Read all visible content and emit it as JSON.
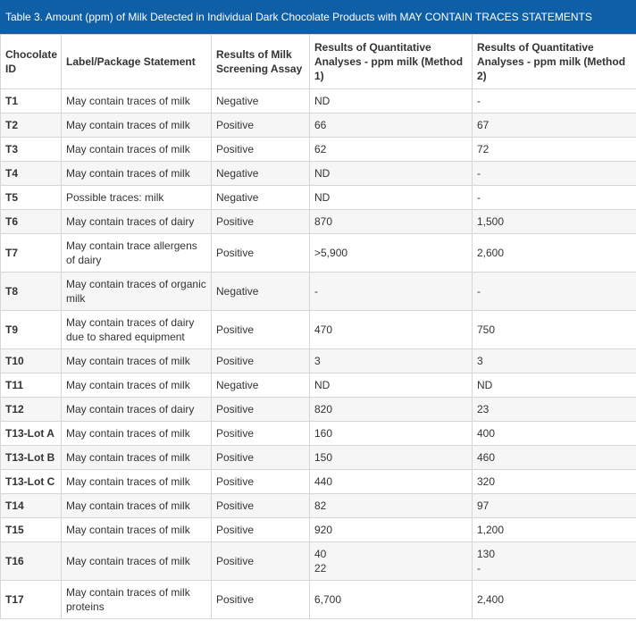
{
  "caption": "Table 3.  Amount (ppm) of Milk Detected in Individual Dark Chocolate Products with MAY CONTAIN TRACES STATEMENTS",
  "headers": [
    "Chocolate ID",
    "Label/Package Statement",
    "Results of Milk Screening Assay",
    "Results of Quantitative Analyses - ppm milk (Method 1)",
    "Results of Quantitative Analyses - ppm milk (Method 2)"
  ],
  "rows": [
    {
      "id": "T1",
      "statement": "May contain traces of milk",
      "screening": "Negative",
      "m1": "ND",
      "m2": "-"
    },
    {
      "id": "T2",
      "statement": "May contain traces of milk",
      "screening": "Positive",
      "m1": "66",
      "m2": "67"
    },
    {
      "id": "T3",
      "statement": "May contain traces of milk",
      "screening": "Positive",
      "m1": "62",
      "m2": "72"
    },
    {
      "id": "T4",
      "statement": "May contain traces of milk",
      "screening": "Negative",
      "m1": "ND",
      "m2": "-"
    },
    {
      "id": "T5",
      "statement": "Possible traces: milk",
      "screening": "Negative",
      "m1": "ND",
      "m2": "-"
    },
    {
      "id": "T6",
      "statement": "May contain traces of dairy",
      "screening": "Positive",
      "m1": "870",
      "m2": "1,500"
    },
    {
      "id": "T7",
      "statement": "May contain trace allergens of dairy",
      "screening": "Positive",
      "m1": ">5,900",
      "m2": "2,600"
    },
    {
      "id": "T8",
      "statement": "May contain traces of organic milk",
      "screening": "Negative",
      "m1": "-",
      "m2": "-"
    },
    {
      "id": "T9",
      "statement": "May contain traces of dairy due to shared equipment",
      "screening": "Positive",
      "m1": "470",
      "m2": "750"
    },
    {
      "id": "T10",
      "statement": "May contain traces of milk",
      "screening": "Positive",
      "m1": "3",
      "m2": "3"
    },
    {
      "id": "T11",
      "statement": "May contain traces of milk",
      "screening": "Negative",
      "m1": "ND",
      "m2": "ND"
    },
    {
      "id": "T12",
      "statement": "May contain traces of dairy",
      "screening": "Positive",
      "m1": "820",
      "m2": "23"
    },
    {
      "id": "T13-Lot A",
      "statement": "May contain traces of milk",
      "screening": "Positive",
      "m1": "160",
      "m2": "400"
    },
    {
      "id": "T13-Lot B",
      "statement": "May contain traces of milk",
      "screening": "Positive",
      "m1": "150",
      "m2": "460"
    },
    {
      "id": "T13-Lot C",
      "statement": "May contain traces of milk",
      "screening": "Positive",
      "m1": "440",
      "m2": "320"
    },
    {
      "id": "T14",
      "statement": "May contain traces of milk",
      "screening": "Positive",
      "m1": "82",
      "m2": "97"
    },
    {
      "id": "T15",
      "statement": "May contain traces of milk",
      "screening": "Positive",
      "m1": "920",
      "m2": "1,200"
    },
    {
      "id": "T16",
      "statement": "May contain traces of milk",
      "screening": "Positive",
      "m1": "40",
      "m1b": "22",
      "m2": "130",
      "m2b": "-"
    },
    {
      "id": "T17",
      "statement": "May contain traces of milk proteins",
      "screening": "Positive",
      "m1": "6,700",
      "m2": "2,400"
    }
  ]
}
